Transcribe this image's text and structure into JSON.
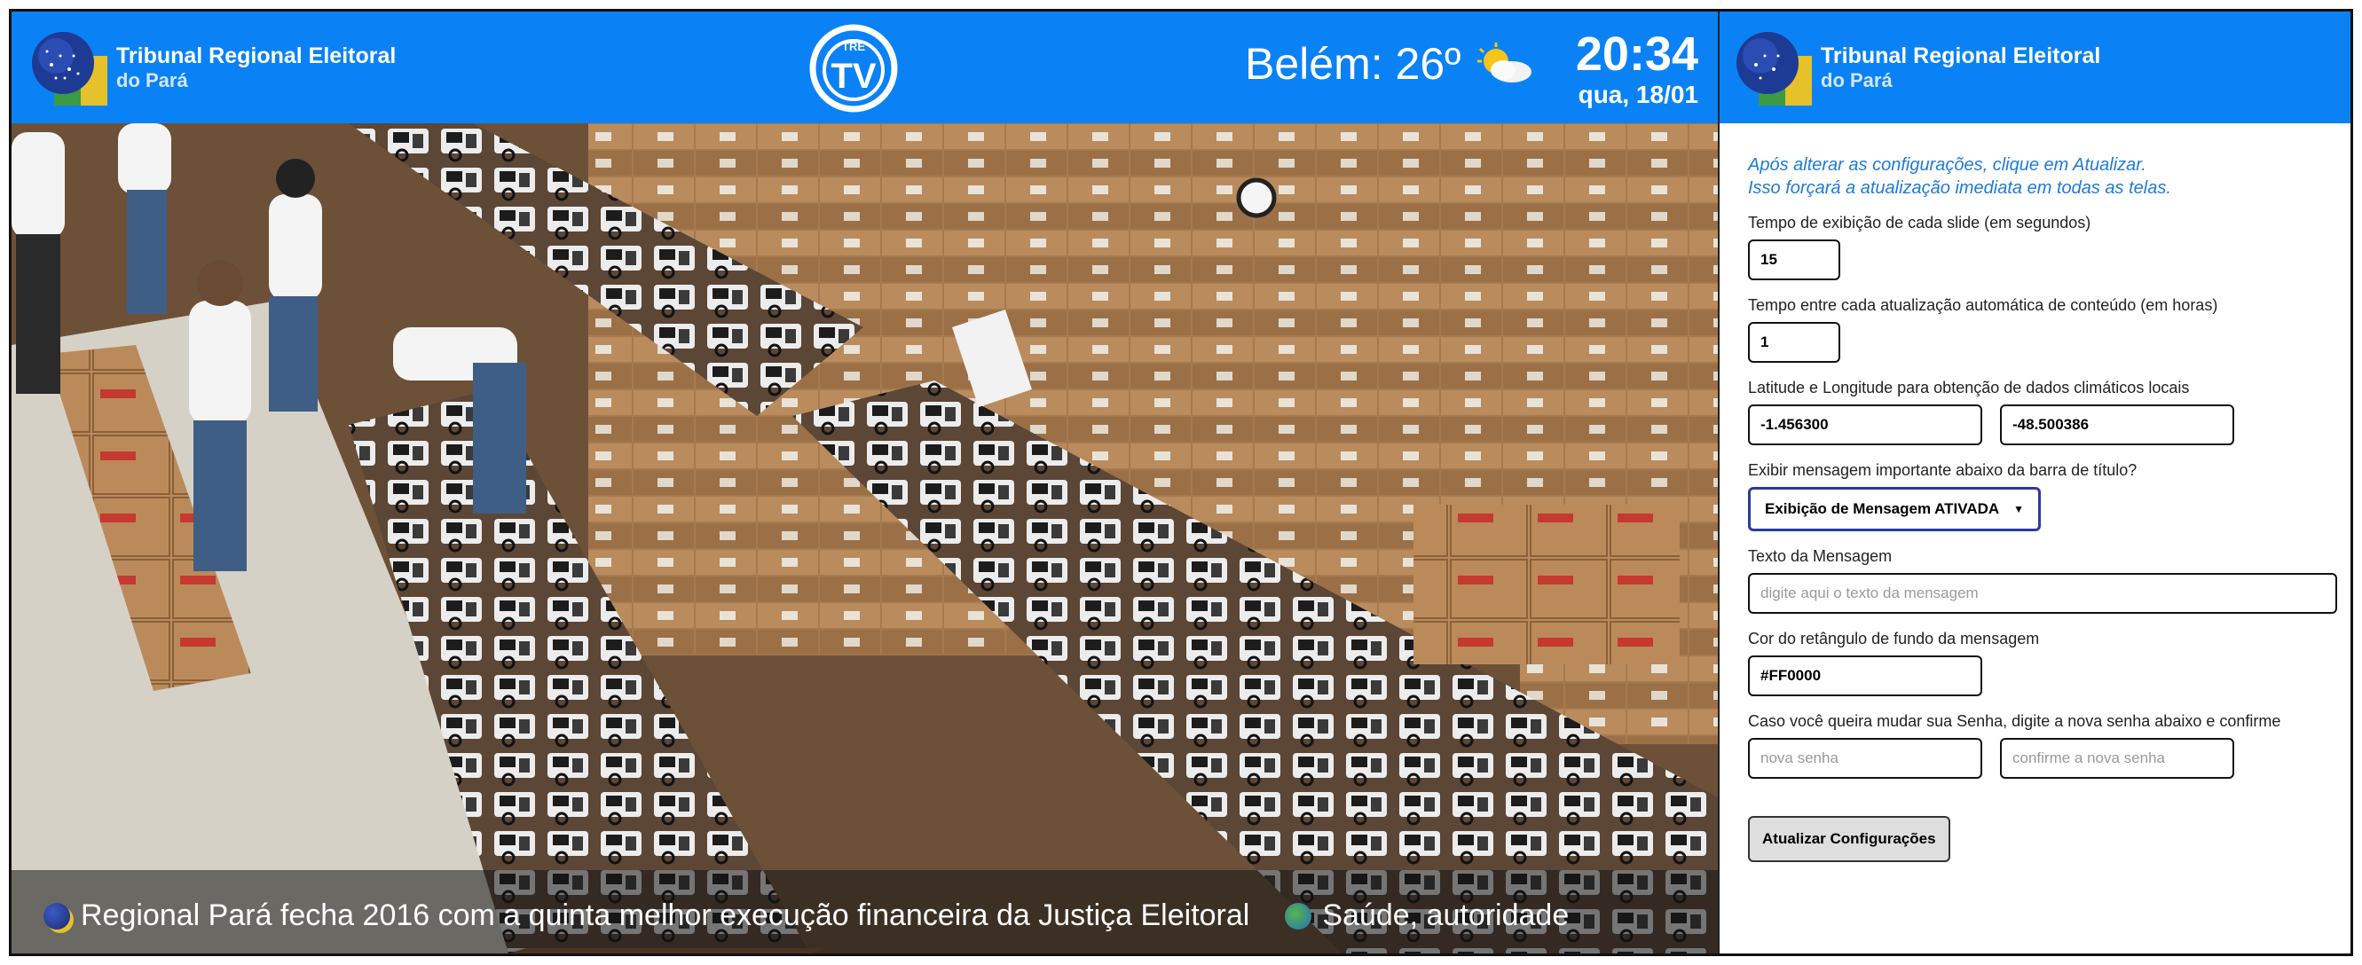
{
  "tv": {
    "org_line1": "Tribunal Regional Eleitoral",
    "org_line2": "do Pará",
    "center_logo_top": "TRE",
    "center_logo_main": "TV",
    "weather": {
      "city_temp": "Belém: 26º",
      "icon": "partly-cloudy-icon"
    },
    "clock": {
      "time": "20:34",
      "date": "qua, 18/01"
    },
    "ticker": [
      "Regional Pará fecha 2016 com a quinta melhor execução financeira da Justiça Eleitoral",
      "Saúde, autoridade"
    ]
  },
  "panel": {
    "org_line1": "Tribunal Regional Eleitoral",
    "org_line2": "do Pará",
    "intro_line1": "Após alterar as configurações, clique em Atualizar.",
    "intro_line2": "Isso forçará a atualização imediata em todas as telas.",
    "slide_label": "Tempo de exibição de cada slide (em segundos)",
    "slide_value": "15",
    "refresh_label": "Tempo entre cada atualização automática de conteúdo (em horas)",
    "refresh_value": "1",
    "coords_label": "Latitude e Longitude para obtenção de dados climáticos locais",
    "latitude": "-1.456300",
    "longitude": "-48.500386",
    "message_toggle_label": "Exibir mensagem importante abaixo da barra de título?",
    "message_toggle_value": "Exibição de Mensagem ATIVADA",
    "message_text_label": "Texto da Mensagem",
    "message_text_placeholder": "digite aqui o texto da mensagem",
    "bg_color_label": "Cor do retângulo de fundo da mensagem",
    "bg_color_value": "#FF0000",
    "password_label": "Caso você queira mudar sua Senha, digite a nova senha abaixo e confirme",
    "password_placeholder": "nova senha",
    "password_confirm_placeholder": "confirme a nova senha",
    "submit_label": "Atualizar Configurações"
  },
  "colors": {
    "header_blue": "#0a82f5",
    "intro_blue": "#1f7ad6"
  }
}
